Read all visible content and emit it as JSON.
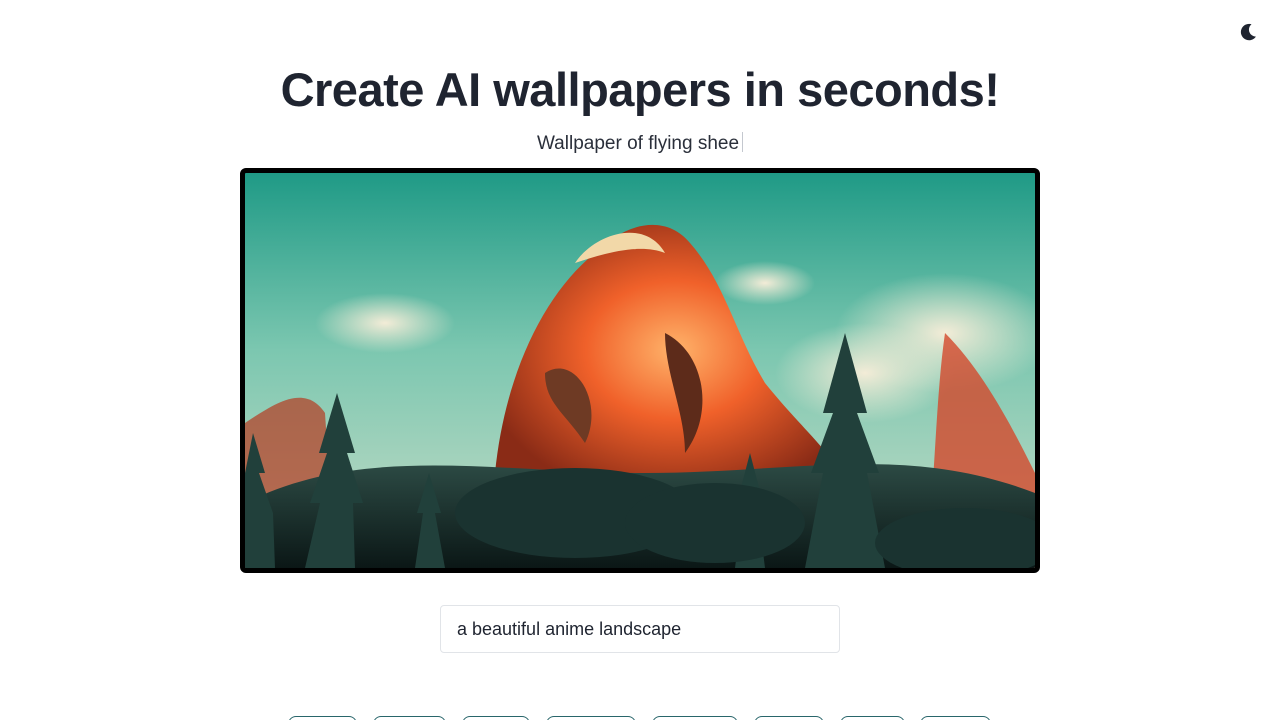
{
  "theme_toggle": {
    "icon": "moon-icon"
  },
  "header": {
    "title": "Create AI wallpapers in seconds!",
    "typing_text": "Wallpaper of flying shee"
  },
  "preview": {
    "icon": "generated-wallpaper-image"
  },
  "prompt": {
    "value": "a beautiful anime landscape"
  },
  "colors": {
    "text": "#1f2430",
    "tag_border": "#29666b",
    "input_border": "#e1e4e8"
  }
}
